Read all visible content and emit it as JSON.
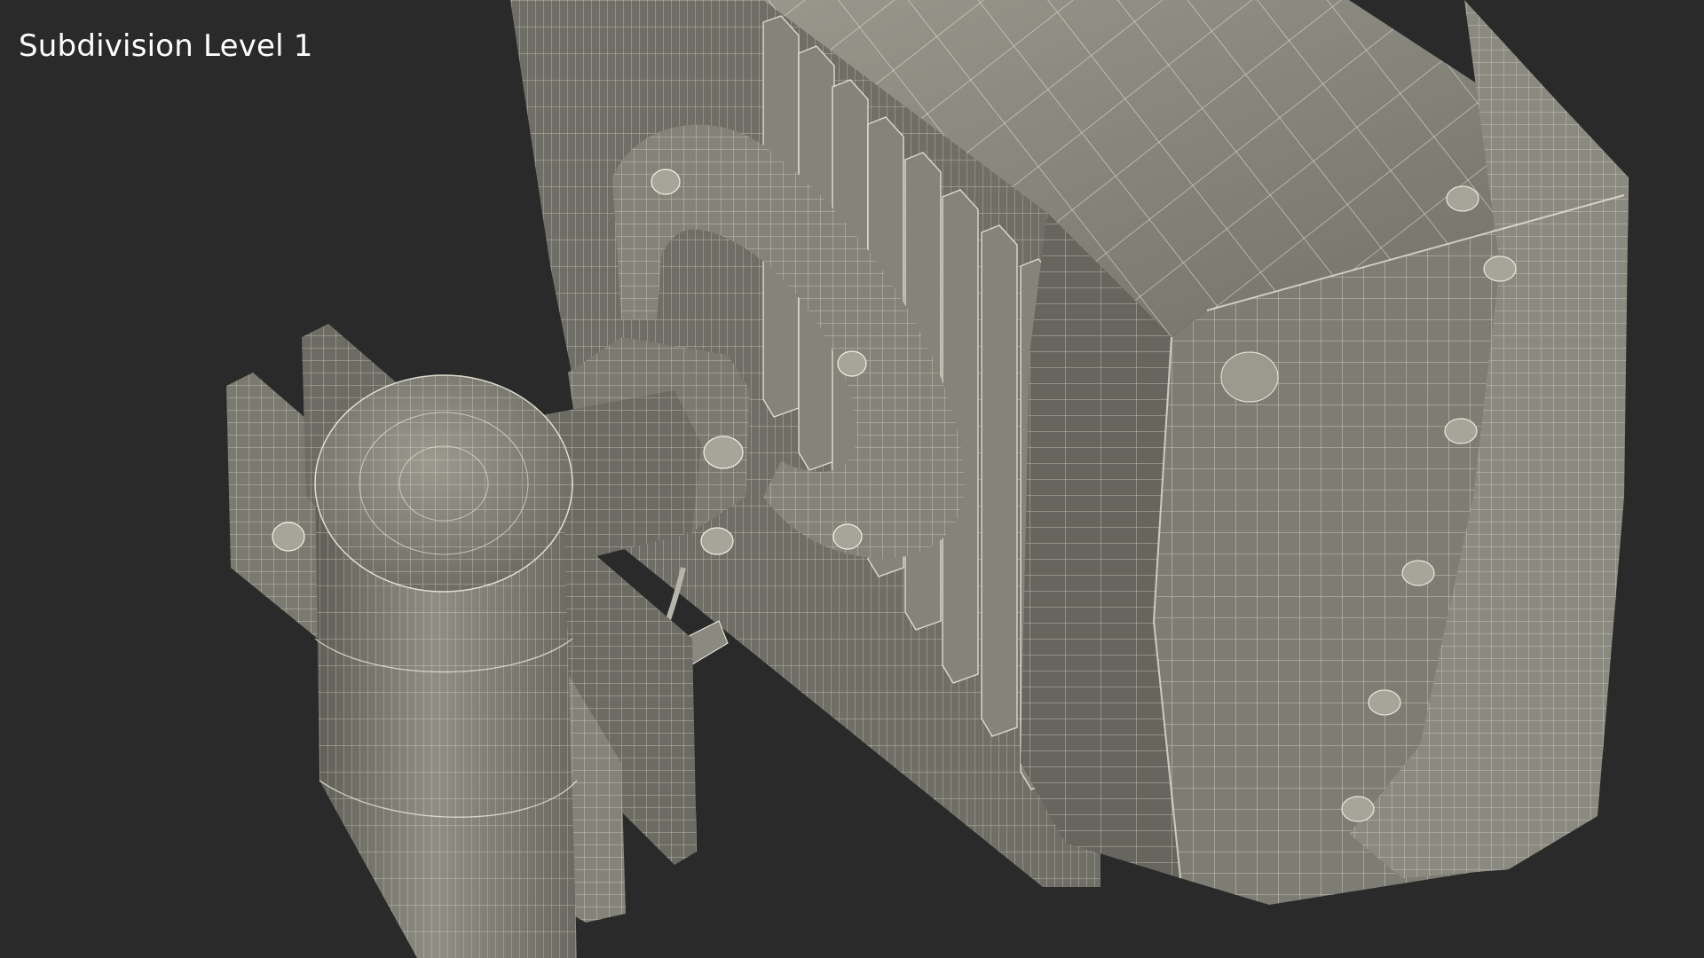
{
  "viewport": {
    "overlay_label": "Subdivision Level 1",
    "background_color": "#2a2a2a",
    "mesh_fill_color": "#8c8c82",
    "mesh_shadow_color": "#5e5e57",
    "wire_color": "#f4f2e4"
  }
}
